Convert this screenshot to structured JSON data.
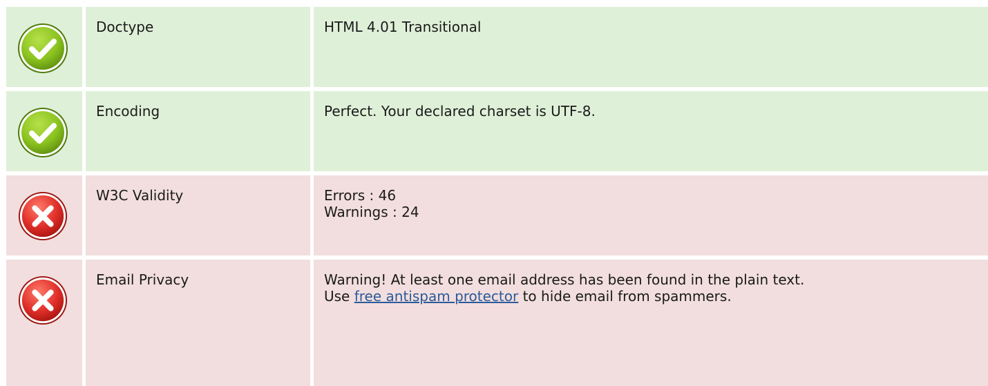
{
  "rows": [
    {
      "status": "pass",
      "icon": "check-icon",
      "name": "Doctype",
      "value": "HTML 4.01 Transitional"
    },
    {
      "status": "pass",
      "icon": "check-icon",
      "name": "Encoding",
      "value": "Perfect. Your declared charset is UTF-8."
    },
    {
      "status": "fail",
      "icon": "error-icon",
      "name": "W3C Validity",
      "errors_line": "Errors : 46",
      "warnings_line": "Warnings : 24"
    },
    {
      "status": "fail",
      "icon": "error-icon",
      "name": "Email Privacy",
      "line1": "Warning! At least one email address has been found in the plain text.",
      "line2_prefix": "Use",
      "link_text": "free antispam protector",
      "line2_suffix": "to hide email from spammers."
    }
  ],
  "colors": {
    "pass_bg": "#dff0d8",
    "fail_bg": "#f2dede",
    "check_green": "#7ab51d",
    "error_red": "#e0302a",
    "link": "#2a5a9a"
  }
}
